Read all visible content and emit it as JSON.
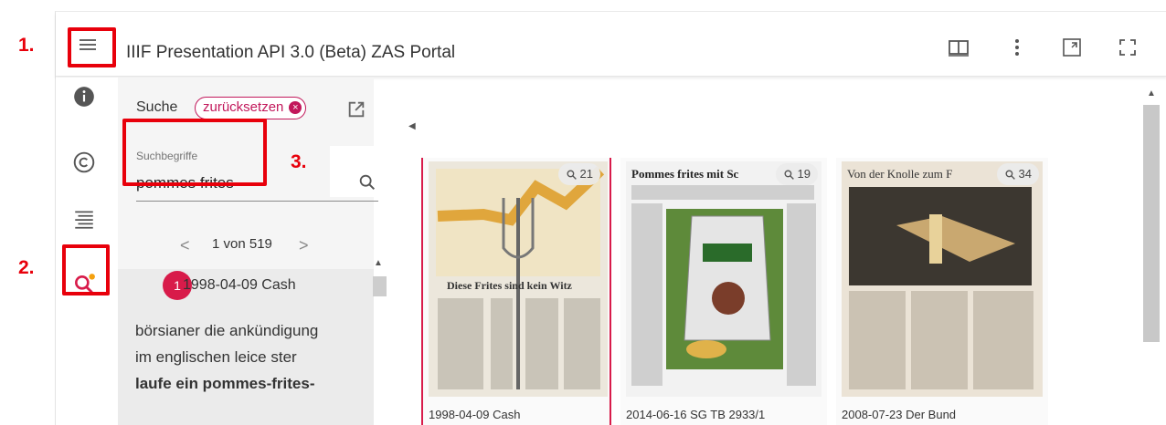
{
  "annotations": [
    "1.",
    "2.",
    "3."
  ],
  "window": {
    "title": "IIIF Presentation API 3.0 (Beta) ZAS Portal"
  },
  "toolbar_icons": [
    "book-view-icon",
    "more-vert-icon",
    "window-size-icon",
    "fullscreen-icon"
  ],
  "rail": {
    "items": [
      "info-icon",
      "copyright-icon",
      "toc-icon",
      "search-icon"
    ],
    "active": "search-icon"
  },
  "search": {
    "heading": "Suche",
    "reset_label": "zurücksetzen",
    "field_label": "Suchbegriffe",
    "query": "pommes frites",
    "pager": {
      "text": "1 von 519",
      "prev": "<",
      "next": ">"
    }
  },
  "results": [
    {
      "index": "1",
      "title": "1998-04-09 Cash",
      "snippet_lines": [
        "börsianer die ankündigung",
        "im englischen leice ster",
        "laufe ein pommes-frites-"
      ]
    }
  ],
  "thumbnails": [
    {
      "label": "1998-04-09 Cash",
      "hits": "21",
      "headline": "Diese Frites sind kein Witz",
      "selected": true
    },
    {
      "label": "2014-06-16 SG TB 2933/1",
      "hits": "19",
      "headline": "Pommes frites mit Sc",
      "selected": false
    },
    {
      "label": "2008-07-23 Der Bund",
      "hits": "34",
      "headline": "Von der Knolle zum F",
      "selected": false
    }
  ],
  "colors": {
    "accent": "#d81b4a",
    "annotation": "#e8000b",
    "panel_bg": "#f5f5f5"
  }
}
